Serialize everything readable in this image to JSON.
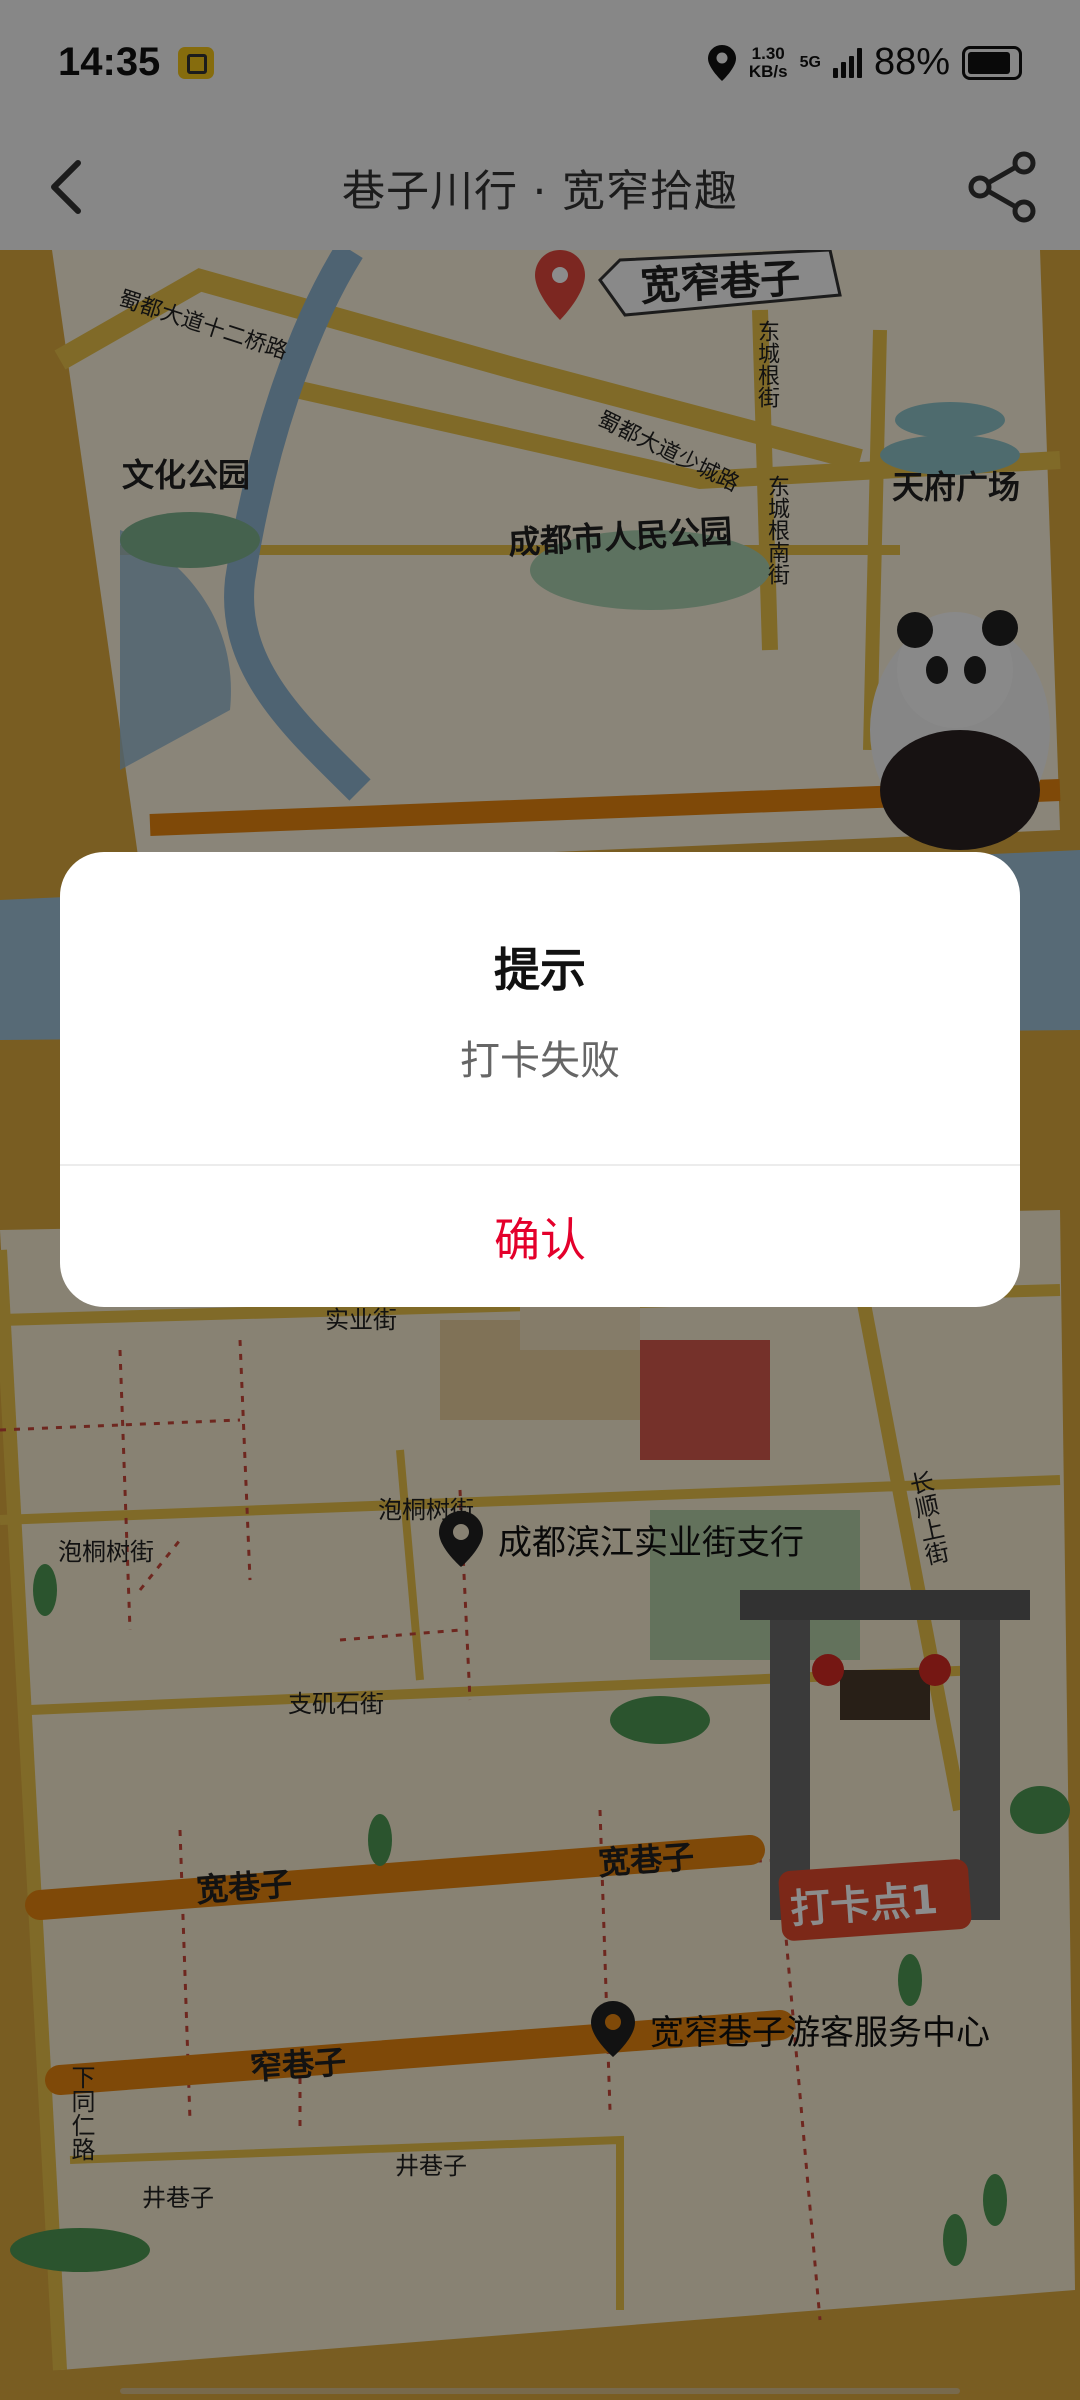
{
  "status_bar": {
    "time": "14:35",
    "net_speed_value": "1.30",
    "net_speed_unit": "KB/s",
    "net_type": "5G",
    "battery_percent": "88%",
    "battery_level": 0.88
  },
  "header": {
    "title": "巷子川行 · 宽窄拾趣"
  },
  "map": {
    "landmark_banner": "宽窄巷子",
    "labels": {
      "park_culture": "文化公园",
      "square_tianfu": "天府广场",
      "park_people": "成都市人民公园",
      "road_shudu_12": "蜀都大道十二桥路",
      "road_shudu_shaocheng": "蜀都大道少城路",
      "road_dongcheng_gen": "东城根街",
      "road_dongcheng_gen_south": "东城根南街",
      "road_shiye": "实业街",
      "road_paotong_left": "泡桐树街",
      "road_paotong_mid": "泡桐树街",
      "road_changshun": "长顺上街",
      "road_zhijishi": "支矶石街",
      "road_kuan_left": "宽巷子",
      "road_kuan_right": "宽巷子",
      "road_zhai": "窄巷子",
      "road_jing_left": "井巷子",
      "road_jing_mid": "井巷子",
      "road_xiatongren": "下同仁路",
      "checkin_badge": "打卡点1"
    },
    "pois": [
      {
        "name": "成都滨江实业街支行"
      },
      {
        "name": "宽窄巷子游客服务中心"
      }
    ]
  },
  "dialog": {
    "title": "提示",
    "message": "打卡失败",
    "confirm_label": "确认"
  },
  "colors": {
    "accent_red": "#e4002b",
    "road_orange": "#e8850f",
    "map_base": "#f6e6bf"
  }
}
